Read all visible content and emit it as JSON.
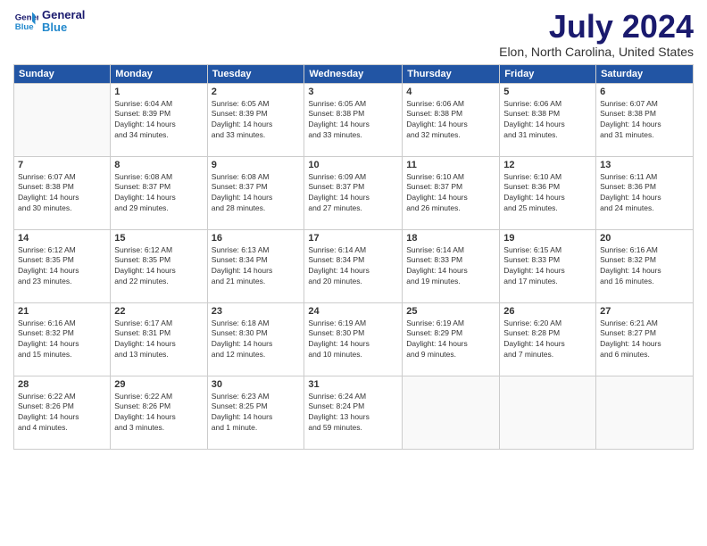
{
  "logo": {
    "line1": "General",
    "line2": "Blue"
  },
  "title": "July 2024",
  "location": "Elon, North Carolina, United States",
  "days_of_week": [
    "Sunday",
    "Monday",
    "Tuesday",
    "Wednesday",
    "Thursday",
    "Friday",
    "Saturday"
  ],
  "weeks": [
    [
      {
        "day": "",
        "info": ""
      },
      {
        "day": "1",
        "info": "Sunrise: 6:04 AM\nSunset: 8:39 PM\nDaylight: 14 hours\nand 34 minutes."
      },
      {
        "day": "2",
        "info": "Sunrise: 6:05 AM\nSunset: 8:39 PM\nDaylight: 14 hours\nand 33 minutes."
      },
      {
        "day": "3",
        "info": "Sunrise: 6:05 AM\nSunset: 8:38 PM\nDaylight: 14 hours\nand 33 minutes."
      },
      {
        "day": "4",
        "info": "Sunrise: 6:06 AM\nSunset: 8:38 PM\nDaylight: 14 hours\nand 32 minutes."
      },
      {
        "day": "5",
        "info": "Sunrise: 6:06 AM\nSunset: 8:38 PM\nDaylight: 14 hours\nand 31 minutes."
      },
      {
        "day": "6",
        "info": "Sunrise: 6:07 AM\nSunset: 8:38 PM\nDaylight: 14 hours\nand 31 minutes."
      }
    ],
    [
      {
        "day": "7",
        "info": "Sunrise: 6:07 AM\nSunset: 8:38 PM\nDaylight: 14 hours\nand 30 minutes."
      },
      {
        "day": "8",
        "info": "Sunrise: 6:08 AM\nSunset: 8:37 PM\nDaylight: 14 hours\nand 29 minutes."
      },
      {
        "day": "9",
        "info": "Sunrise: 6:08 AM\nSunset: 8:37 PM\nDaylight: 14 hours\nand 28 minutes."
      },
      {
        "day": "10",
        "info": "Sunrise: 6:09 AM\nSunset: 8:37 PM\nDaylight: 14 hours\nand 27 minutes."
      },
      {
        "day": "11",
        "info": "Sunrise: 6:10 AM\nSunset: 8:37 PM\nDaylight: 14 hours\nand 26 minutes."
      },
      {
        "day": "12",
        "info": "Sunrise: 6:10 AM\nSunset: 8:36 PM\nDaylight: 14 hours\nand 25 minutes."
      },
      {
        "day": "13",
        "info": "Sunrise: 6:11 AM\nSunset: 8:36 PM\nDaylight: 14 hours\nand 24 minutes."
      }
    ],
    [
      {
        "day": "14",
        "info": "Sunrise: 6:12 AM\nSunset: 8:35 PM\nDaylight: 14 hours\nand 23 minutes."
      },
      {
        "day": "15",
        "info": "Sunrise: 6:12 AM\nSunset: 8:35 PM\nDaylight: 14 hours\nand 22 minutes."
      },
      {
        "day": "16",
        "info": "Sunrise: 6:13 AM\nSunset: 8:34 PM\nDaylight: 14 hours\nand 21 minutes."
      },
      {
        "day": "17",
        "info": "Sunrise: 6:14 AM\nSunset: 8:34 PM\nDaylight: 14 hours\nand 20 minutes."
      },
      {
        "day": "18",
        "info": "Sunrise: 6:14 AM\nSunset: 8:33 PM\nDaylight: 14 hours\nand 19 minutes."
      },
      {
        "day": "19",
        "info": "Sunrise: 6:15 AM\nSunset: 8:33 PM\nDaylight: 14 hours\nand 17 minutes."
      },
      {
        "day": "20",
        "info": "Sunrise: 6:16 AM\nSunset: 8:32 PM\nDaylight: 14 hours\nand 16 minutes."
      }
    ],
    [
      {
        "day": "21",
        "info": "Sunrise: 6:16 AM\nSunset: 8:32 PM\nDaylight: 14 hours\nand 15 minutes."
      },
      {
        "day": "22",
        "info": "Sunrise: 6:17 AM\nSunset: 8:31 PM\nDaylight: 14 hours\nand 13 minutes."
      },
      {
        "day": "23",
        "info": "Sunrise: 6:18 AM\nSunset: 8:30 PM\nDaylight: 14 hours\nand 12 minutes."
      },
      {
        "day": "24",
        "info": "Sunrise: 6:19 AM\nSunset: 8:30 PM\nDaylight: 14 hours\nand 10 minutes."
      },
      {
        "day": "25",
        "info": "Sunrise: 6:19 AM\nSunset: 8:29 PM\nDaylight: 14 hours\nand 9 minutes."
      },
      {
        "day": "26",
        "info": "Sunrise: 6:20 AM\nSunset: 8:28 PM\nDaylight: 14 hours\nand 7 minutes."
      },
      {
        "day": "27",
        "info": "Sunrise: 6:21 AM\nSunset: 8:27 PM\nDaylight: 14 hours\nand 6 minutes."
      }
    ],
    [
      {
        "day": "28",
        "info": "Sunrise: 6:22 AM\nSunset: 8:26 PM\nDaylight: 14 hours\nand 4 minutes."
      },
      {
        "day": "29",
        "info": "Sunrise: 6:22 AM\nSunset: 8:26 PM\nDaylight: 14 hours\nand 3 minutes."
      },
      {
        "day": "30",
        "info": "Sunrise: 6:23 AM\nSunset: 8:25 PM\nDaylight: 14 hours\nand 1 minute."
      },
      {
        "day": "31",
        "info": "Sunrise: 6:24 AM\nSunset: 8:24 PM\nDaylight: 13 hours\nand 59 minutes."
      },
      {
        "day": "",
        "info": ""
      },
      {
        "day": "",
        "info": ""
      },
      {
        "day": "",
        "info": ""
      }
    ]
  ]
}
